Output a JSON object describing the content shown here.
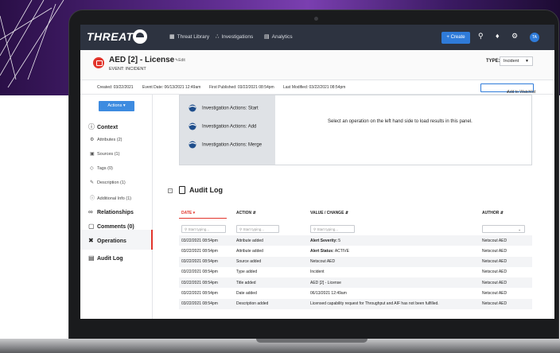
{
  "nav": {
    "logo": "THREATQ",
    "items": [
      {
        "icon": "grid-icon",
        "label": "Threat Library"
      },
      {
        "icon": "graph-icon",
        "label": "Investigations"
      },
      {
        "icon": "chart-icon",
        "label": "Analytics"
      }
    ],
    "create_label": "+ Create",
    "avatar_initials": "TA"
  },
  "object": {
    "title": "AED [2] - License",
    "edit_label": "Edit",
    "subtitle": "EVENT: INCIDENT",
    "type_label": "TYPE:",
    "type_value": "Incident"
  },
  "meta": {
    "created": "Created: 03/22/2021",
    "event_date": "Event Date: 06/13/2021 12:49am",
    "first_published": "First Published: 03/22/2021 08:54pm",
    "last_modified": "Last Modified: 03/22/2021 08:54pm",
    "watchlist_label": "Add to Watchlist"
  },
  "sidebar": {
    "actions_label": "Actions",
    "context_label": "Context",
    "context_items": [
      {
        "icon": "gear-icon",
        "label": "Attributes (2)"
      },
      {
        "icon": "box-icon",
        "label": "Sources (1)"
      },
      {
        "icon": "tag-icon",
        "label": "Tags (0)"
      },
      {
        "icon": "pencil-icon",
        "label": "Description (1)"
      },
      {
        "icon": "info-icon",
        "label": "Additional Info (1)"
      }
    ],
    "sections": [
      {
        "icon": "link-icon",
        "label": "Relationships"
      },
      {
        "icon": "comments-icon",
        "label": "Comments (0)"
      },
      {
        "icon": "tools-icon",
        "label": "Operations"
      },
      {
        "icon": "document-icon",
        "label": "Audit Log"
      }
    ]
  },
  "operations": {
    "items": [
      "Investigation Actions: Start",
      "Investigation Actions: Add",
      "Investigation Actions: Merge"
    ],
    "placeholder_message": "Select an operation on the left hand side to load results in this panel."
  },
  "audit_log": {
    "title": "Audit Log",
    "columns": [
      "DATE",
      "ACTION",
      "VALUE / CHANGE",
      "AUTHOR"
    ],
    "filter_placeholder": "Start typing...",
    "rows": [
      {
        "date": "03/22/2021 08:54pm",
        "action": "Attribute added",
        "value_label": "Alert Severity:",
        "value": " 5",
        "author": "Netscout AED"
      },
      {
        "date": "03/22/2021 08:54pm",
        "action": "Attribute added",
        "value_label": "Alert Status:",
        "value": " ACTIVE",
        "author": "Netscout AED"
      },
      {
        "date": "03/22/2021 08:54pm",
        "action": "Source added",
        "value_label": "",
        "value": "Netscout AED",
        "author": "Netscout AED"
      },
      {
        "date": "03/22/2021 08:54pm",
        "action": "Type added",
        "value_label": "",
        "value": "Incident",
        "author": "Netscout AED"
      },
      {
        "date": "03/22/2021 08:54pm",
        "action": "Title added",
        "value_label": "",
        "value": "AED [2] - License",
        "author": "Netscout AED"
      },
      {
        "date": "03/22/2021 08:54pm",
        "action": "Date added",
        "value_label": "",
        "value": "06/13/2021 12:49am",
        "author": "Netscout AED"
      },
      {
        "date": "03/22/2021 08:54pm",
        "action": "Description added",
        "value_label": "",
        "value": "Licensed capability request for Throughput and AIF has not been fulfilled.",
        "author": "Netscout AED"
      }
    ]
  }
}
